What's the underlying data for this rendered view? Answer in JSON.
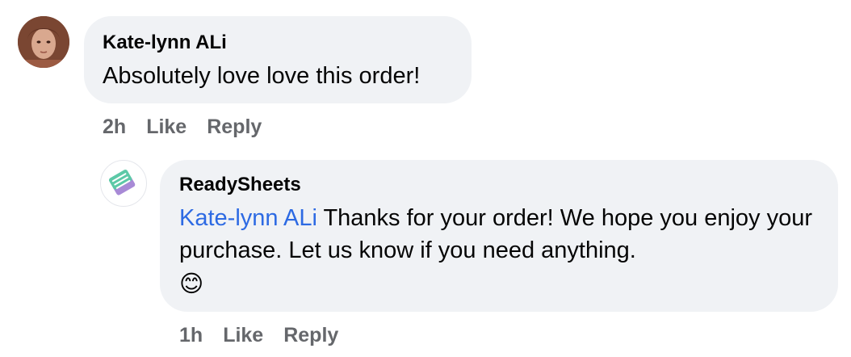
{
  "comments": [
    {
      "author": "Kate-lynn ALi",
      "text": "Absolutely love love this order!",
      "time": "2h",
      "like_label": "Like",
      "reply_label": "Reply",
      "avatar_icon": "user-photo-avatar"
    }
  ],
  "reply": {
    "author": "ReadySheets",
    "mention": "Kate-lynn ALi",
    "text": "Thanks for your order! We hope you enjoy your purchase. Let us know if you need anything.",
    "emoji": "😊",
    "time": "1h",
    "like_label": "Like",
    "reply_label": "Reply",
    "avatar_icon": "readysheets-logo-icon"
  },
  "colors": {
    "bubble_bg": "#f0f2f5",
    "action_text": "#65676b",
    "mention_link": "#2d6ae3",
    "logo_green": "#5cc9a7",
    "logo_purple": "#a88ad6"
  }
}
